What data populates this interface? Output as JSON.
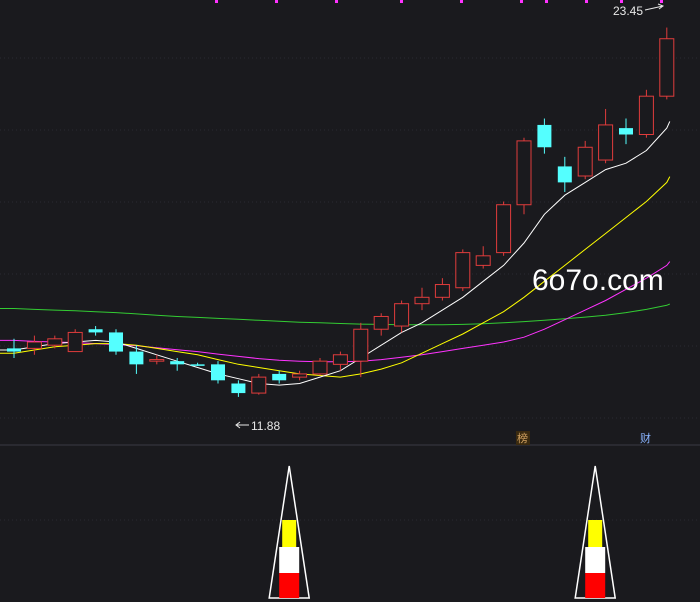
{
  "chart_data": {
    "type": "candlestick",
    "watermark": "6o7o.com",
    "price_high_label": "23.45",
    "price_low_label": "11.88",
    "badges": {
      "left": "榜",
      "right": "财"
    },
    "colors": {
      "up": "#e03c3c",
      "down": "#54ffff",
      "ma5": "#ffffff",
      "ma10": "#ffff00",
      "ma20": "#ff33ff",
      "ma60": "#33cc33",
      "background": "#1a1a1e"
    },
    "ylim": [
      11,
      24
    ],
    "candles": [
      {
        "o": 13.4,
        "h": 13.7,
        "l": 13.1,
        "c": 13.3
      },
      {
        "o": 13.4,
        "h": 13.8,
        "l": 13.2,
        "c": 13.6
      },
      {
        "o": 13.5,
        "h": 13.8,
        "l": 13.4,
        "c": 13.7
      },
      {
        "o": 13.3,
        "h": 14.0,
        "l": 13.3,
        "c": 13.9
      },
      {
        "o": 14.0,
        "h": 14.1,
        "l": 13.8,
        "c": 13.9
      },
      {
        "o": 13.9,
        "h": 14.0,
        "l": 13.2,
        "c": 13.3
      },
      {
        "o": 13.3,
        "h": 13.5,
        "l": 12.6,
        "c": 12.9
      },
      {
        "o": 13.0,
        "h": 13.2,
        "l": 12.9,
        "c": 13.05
      },
      {
        "o": 13.0,
        "h": 13.1,
        "l": 12.7,
        "c": 12.9
      },
      {
        "o": 12.9,
        "h": 12.95,
        "l": 12.85,
        "c": 12.88
      },
      {
        "o": 12.9,
        "h": 13.0,
        "l": 12.3,
        "c": 12.4
      },
      {
        "o": 12.3,
        "h": 12.4,
        "l": 11.88,
        "c": 12.0
      },
      {
        "o": 12.0,
        "h": 12.6,
        "l": 11.95,
        "c": 12.5
      },
      {
        "o": 12.6,
        "h": 12.7,
        "l": 12.3,
        "c": 12.4
      },
      {
        "o": 12.5,
        "h": 12.7,
        "l": 12.4,
        "c": 12.6
      },
      {
        "o": 12.6,
        "h": 13.1,
        "l": 12.55,
        "c": 13.0
      },
      {
        "o": 12.9,
        "h": 13.3,
        "l": 12.7,
        "c": 13.2
      },
      {
        "o": 13.0,
        "h": 14.2,
        "l": 12.5,
        "c": 14.0
      },
      {
        "o": 14.0,
        "h": 14.5,
        "l": 13.8,
        "c": 14.4
      },
      {
        "o": 14.1,
        "h": 14.9,
        "l": 13.9,
        "c": 14.8
      },
      {
        "o": 14.8,
        "h": 15.3,
        "l": 14.6,
        "c": 15.0
      },
      {
        "o": 15.0,
        "h": 15.6,
        "l": 14.9,
        "c": 15.4
      },
      {
        "o": 15.3,
        "h": 16.5,
        "l": 15.2,
        "c": 16.4
      },
      {
        "o": 16.0,
        "h": 16.6,
        "l": 15.9,
        "c": 16.3
      },
      {
        "o": 16.4,
        "h": 18.0,
        "l": 16.3,
        "c": 17.9
      },
      {
        "o": 17.9,
        "h": 20.0,
        "l": 17.6,
        "c": 19.9
      },
      {
        "o": 20.4,
        "h": 20.6,
        "l": 19.5,
        "c": 19.7
      },
      {
        "o": 19.1,
        "h": 19.4,
        "l": 18.3,
        "c": 18.6
      },
      {
        "o": 18.8,
        "h": 19.9,
        "l": 18.7,
        "c": 19.7
      },
      {
        "o": 19.3,
        "h": 20.9,
        "l": 19.2,
        "c": 20.4
      },
      {
        "o": 20.3,
        "h": 20.6,
        "l": 19.8,
        "c": 20.1
      },
      {
        "o": 20.1,
        "h": 21.5,
        "l": 20.0,
        "c": 21.3
      },
      {
        "o": 21.3,
        "h": 23.45,
        "l": 21.2,
        "c": 23.1
      }
    ],
    "ma5": [
      13.35,
      13.45,
      13.55,
      13.6,
      13.65,
      13.6,
      13.4,
      13.2,
      13.0,
      12.8,
      12.6,
      12.45,
      12.3,
      12.25,
      12.3,
      12.5,
      12.7,
      13.1,
      13.5,
      13.9,
      14.2,
      14.6,
      15.0,
      15.5,
      16.0,
      16.7,
      17.6,
      18.2,
      18.6,
      19.0,
      19.2,
      19.6,
      20.3
    ],
    "ma10": [
      13.25,
      13.35,
      13.45,
      13.5,
      13.55,
      13.55,
      13.5,
      13.4,
      13.3,
      13.2,
      13.05,
      12.9,
      12.8,
      12.7,
      12.6,
      12.55,
      12.5,
      12.6,
      12.75,
      12.95,
      13.25,
      13.55,
      13.85,
      14.2,
      14.55,
      15.0,
      15.5,
      16.0,
      16.5,
      17.0,
      17.5,
      18.0,
      18.6
    ],
    "ma20": [
      13.65,
      13.62,
      13.6,
      13.58,
      13.55,
      13.52,
      13.48,
      13.42,
      13.36,
      13.3,
      13.22,
      13.15,
      13.08,
      13.03,
      13.0,
      12.98,
      12.98,
      13.0,
      13.05,
      13.12,
      13.2,
      13.3,
      13.4,
      13.5,
      13.6,
      13.75,
      14.0,
      14.3,
      14.6,
      14.9,
      15.25,
      15.6,
      16.0
    ],
    "ma60": [
      14.65,
      14.62,
      14.6,
      14.58,
      14.55,
      14.52,
      14.48,
      14.44,
      14.4,
      14.37,
      14.34,
      14.31,
      14.28,
      14.25,
      14.22,
      14.2,
      14.18,
      14.16,
      14.15,
      14.14,
      14.14,
      14.14,
      14.15,
      14.17,
      14.2,
      14.24,
      14.28,
      14.33,
      14.38,
      14.44,
      14.52,
      14.62,
      14.75
    ],
    "signals": [
      {
        "index": 13
      },
      {
        "index": 28
      }
    ]
  }
}
